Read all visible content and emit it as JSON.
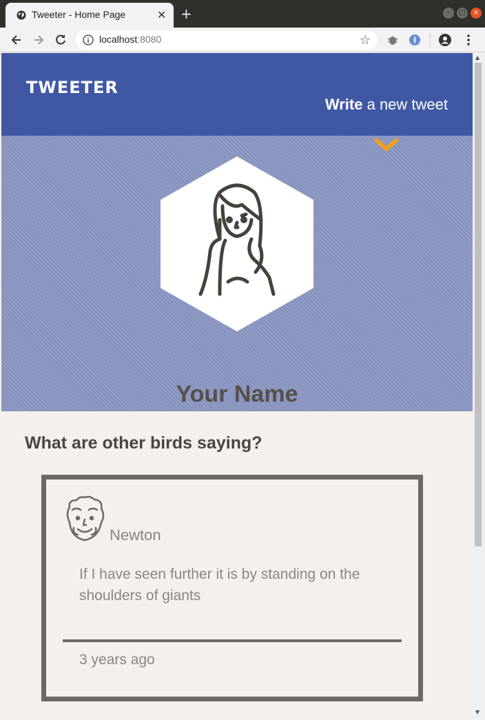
{
  "browser": {
    "tab_title": "Tweeter - Home Page",
    "tab_close": "✕",
    "new_tab": "+",
    "url_host": "localhost",
    "url_port": ":8080",
    "bookmark_star": "☆"
  },
  "nav": {
    "brand": "TWEETER",
    "compose_bold": "Write",
    "compose_rest": " a new tweet"
  },
  "profile": {
    "name": "Your Name"
  },
  "feed": {
    "heading": "What are other birds saying?",
    "tweets": [
      {
        "user": "Newton",
        "content": "If I have seen further it is by standing on the shoulders of giants",
        "timestamp": "3 years ago"
      }
    ]
  },
  "colors": {
    "nav_bg": "#4058a4",
    "hero_bg": "#8a97c2",
    "accent": "#f0a020",
    "page_bg": "#f4f1ec",
    "text_dark": "#4a4540",
    "text_muted": "#8a8580"
  },
  "icons": [
    "globe-icon",
    "close-icon",
    "back-icon",
    "forward-icon",
    "reload-icon",
    "info-icon",
    "star-icon",
    "bug-extension-icon",
    "shield-extension-icon",
    "account-icon",
    "menu-icon",
    "chevron-down-icon",
    "female-avatar-icon",
    "newton-avatar-icon"
  ]
}
